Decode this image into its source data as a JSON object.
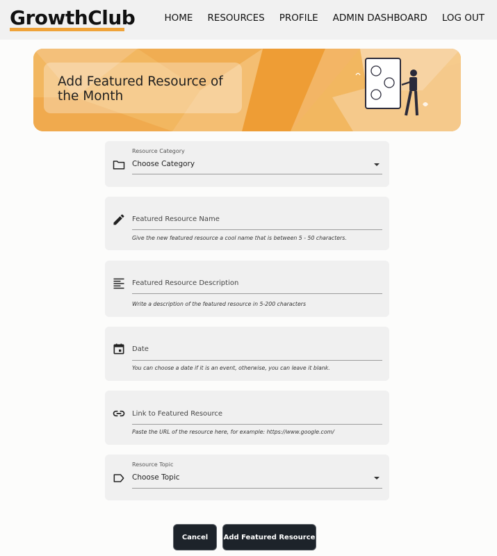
{
  "header": {
    "logo": "GrowthClub",
    "nav": [
      "HOME",
      "RESOURCES",
      "PROFILE",
      "ADMIN DASHBOARD",
      "LOG OUT"
    ]
  },
  "banner": {
    "title": "Add Featured Resource of the Month"
  },
  "form": {
    "category": {
      "label": "Resource Category",
      "value": "Choose Category",
      "icon": "folder-icon"
    },
    "name": {
      "placeholder": "Featured Resource Name",
      "hint": "Give the new featured resource a cool name that is between 5 - 50 characters.",
      "icon": "pencil-icon"
    },
    "description": {
      "placeholder": "Featured Resource Description",
      "hint": "Write a description of the featured resource in 5-200 characters",
      "icon": "text-lines-icon"
    },
    "date": {
      "placeholder": "Date",
      "hint": "You can choose a date if it is an event, otherwise, you can leave it blank.",
      "icon": "calendar-icon"
    },
    "link": {
      "placeholder": "Link to Featured Resource",
      "hint": "Paste the URL of the resource here, for example: https://www.google.com/",
      "icon": "link-icon"
    },
    "topic": {
      "label": "Resource Topic",
      "value": "Choose Topic",
      "icon": "tag-icon"
    }
  },
  "buttons": {
    "cancel": "Cancel",
    "submit": "Add Featured Resource"
  },
  "colors": {
    "accent": "#efa33a",
    "button": "#1d232a"
  }
}
